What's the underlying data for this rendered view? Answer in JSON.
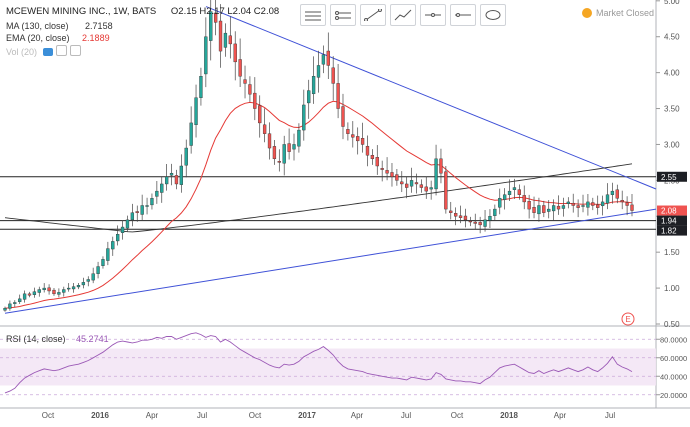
{
  "header": {
    "symbol": "MCEWEN MINING INC., 1W, BATS",
    "ohlc": "O2.15 H2.17 L2.04 C2.08",
    "market_status": "Market Closed"
  },
  "indicators": [
    {
      "label": "MA (130, close)",
      "value": "2.7158",
      "color": "#333333"
    },
    {
      "label": "EMA (20, close)",
      "value": "2.1889",
      "color": "#e53935"
    },
    {
      "label": "Vol (20)",
      "value": "",
      "color": "#bbbbbb"
    }
  ],
  "rsi": {
    "label": "RSI (14, close)",
    "value": "45.2741",
    "color": "#9b59b6"
  },
  "toolbar": [
    "horizontal-lines-icon",
    "ray-lines-icon",
    "trend-line-icon",
    "polyline-icon",
    "horizontal-ray-icon",
    "arrow-line-icon",
    "ellipse-icon"
  ],
  "colors": {
    "up": "#26a69a",
    "down": "#ef5350",
    "trend": "#3f51d7",
    "ema": "#e53935",
    "ma": "#333333",
    "rsi": "#9b59b6"
  },
  "chart_data": {
    "type": "candlestick",
    "price_axis": {
      "min": 0.5,
      "max": 4.9,
      "ticks": [
        "5.00",
        "4.50",
        "4.00",
        "3.50",
        "3.00",
        "2.50",
        "2.00",
        "1.50",
        "1.00",
        "0.50"
      ]
    },
    "price_labels": [
      {
        "value": "2.55",
        "price": 2.55,
        "style": "dark"
      },
      {
        "value": "2.08",
        "price": 2.08,
        "style": "red"
      },
      {
        "value": "1.94",
        "price": 1.94,
        "style": "dark"
      },
      {
        "value": "1.82",
        "price": 1.82,
        "style": "dark"
      }
    ],
    "horizontal_lines": [
      2.55,
      1.94,
      1.82
    ],
    "time_axis": [
      "Oct",
      "2016",
      "Apr",
      "Jul",
      "Oct",
      "2017",
      "Apr",
      "Jul",
      "Oct",
      "2018",
      "Apr",
      "Jul"
    ],
    "rsi_axis": {
      "min": 10,
      "max": 90,
      "ticks": [
        "80.0000",
        "60.0000",
        "40.0000",
        "20.0000"
      ],
      "band": [
        30,
        70
      ]
    },
    "closes": [
      0.72,
      0.78,
      0.8,
      0.85,
      0.92,
      0.9,
      0.95,
      0.98,
      1.0,
      0.96,
      0.92,
      0.94,
      0.98,
      1.0,
      1.02,
      1.04,
      1.08,
      1.12,
      1.2,
      1.3,
      1.4,
      1.55,
      1.65,
      1.75,
      1.85,
      1.95,
      2.05,
      2.05,
      2.15,
      2.15,
      2.25,
      2.35,
      2.45,
      2.55,
      2.6,
      2.45,
      2.7,
      2.95,
      3.3,
      3.65,
      3.95,
      4.5,
      4.85,
      4.7,
      4.3,
      4.55,
      4.4,
      4.15,
      3.95,
      3.85,
      3.7,
      3.5,
      3.3,
      3.15,
      2.95,
      2.8,
      2.75,
      3.0,
      2.9,
      3.0,
      3.2,
      3.55,
      3.75,
      3.95,
      4.1,
      4.25,
      4.1,
      3.85,
      3.5,
      3.25,
      3.15,
      3.1,
      3.05,
      3.0,
      2.85,
      2.8,
      2.7,
      2.65,
      2.6,
      2.55,
      2.5,
      2.45,
      2.4,
      2.5,
      2.45,
      2.4,
      2.35,
      2.4,
      2.8,
      2.6,
      2.1,
      2.05,
      2.0,
      1.98,
      1.95,
      1.92,
      1.9,
      1.88,
      1.95,
      2.0,
      2.1,
      2.25,
      2.3,
      2.35,
      2.4,
      2.3,
      2.2,
      2.1,
      2.05,
      2.15,
      2.05,
      2.1,
      2.15,
      2.1,
      2.15,
      2.2,
      2.15,
      2.12,
      2.15,
      2.2,
      2.15,
      2.12,
      2.2,
      2.3,
      2.35,
      2.25,
      2.2,
      2.15,
      2.08
    ],
    "rsi_values": [
      22,
      24,
      27,
      33,
      38,
      41,
      44,
      46,
      48,
      47,
      46,
      47,
      49,
      51,
      52,
      53,
      55,
      57,
      60,
      63,
      66,
      70,
      74,
      77,
      78,
      77,
      76,
      77,
      79,
      79,
      80,
      82,
      81,
      83,
      83,
      80,
      82,
      84,
      86,
      87,
      85,
      82,
      84,
      83,
      77,
      80,
      77,
      73,
      69,
      66,
      63,
      60,
      58,
      55,
      52,
      50,
      49,
      53,
      52,
      53,
      56,
      61,
      64,
      67,
      69,
      72,
      68,
      63,
      56,
      51,
      48,
      47,
      46,
      45,
      43,
      42,
      41,
      40,
      39,
      38,
      38,
      37,
      36,
      39,
      38,
      37,
      36,
      37,
      44,
      42,
      37,
      36,
      35,
      35,
      34,
      34,
      33,
      32,
      36,
      39,
      44,
      49,
      51,
      52,
      53,
      50,
      47,
      44,
      43,
      46,
      43,
      45,
      47,
      45,
      47,
      49,
      47,
      45,
      47,
      50,
      47,
      45,
      49,
      54,
      61,
      53,
      50,
      48,
      45
    ]
  }
}
